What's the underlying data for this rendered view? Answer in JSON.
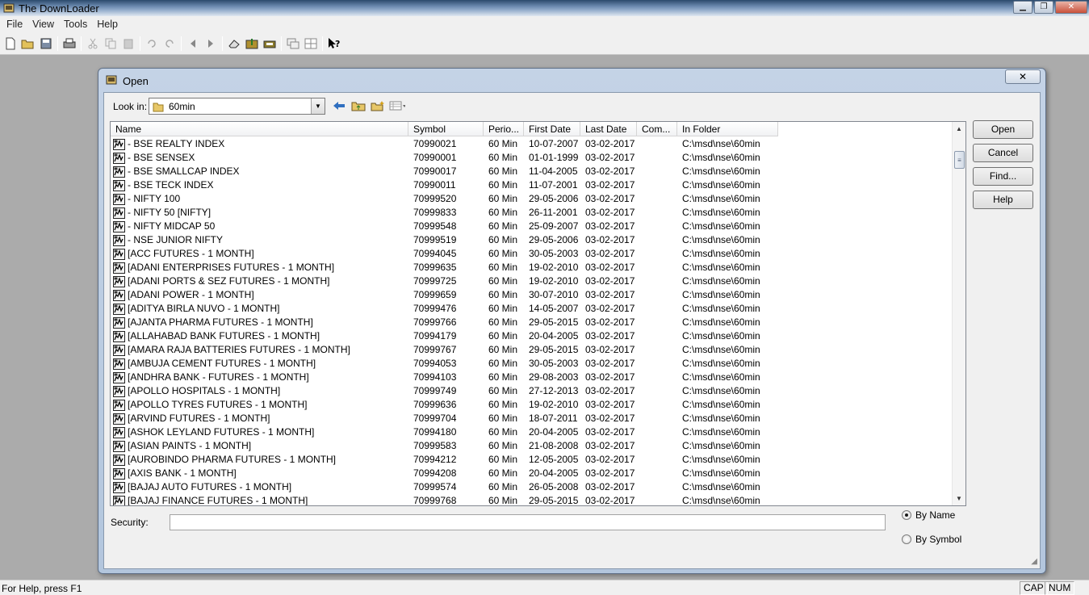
{
  "window": {
    "title": "The DownLoader"
  },
  "menubar": {
    "items": [
      "File",
      "View",
      "Tools",
      "Help"
    ]
  },
  "toolbar": {
    "icons": [
      "new-icon",
      "open-icon",
      "save-icon",
      "print-icon",
      "cut-icon",
      "copy-icon",
      "paste-icon",
      "undo-icon",
      "redo-icon",
      "back-icon",
      "forward-icon",
      "tool1-icon",
      "tool2-icon",
      "tool3-icon",
      "window-icon",
      "grid-icon",
      "help-pointer-icon"
    ]
  },
  "dialog": {
    "title": "Open",
    "close_label": "✕",
    "look_in_label": "Look in:",
    "look_in_value": "60min",
    "columns": [
      "Name",
      "Symbol",
      "Perio...",
      "First Date",
      "Last Date",
      "Com...",
      "In Folder"
    ],
    "rows": [
      {
        "name": "- BSE REALTY INDEX",
        "symbol": "70990021",
        "period": "60 Min",
        "first": "10-07-2007",
        "last": "03-02-2017",
        "com": "",
        "folder": "C:\\msd\\nse\\60min"
      },
      {
        "name": "- BSE SENSEX",
        "symbol": "70990001",
        "period": "60 Min",
        "first": "01-01-1999",
        "last": "03-02-2017",
        "com": "",
        "folder": "C:\\msd\\nse\\60min"
      },
      {
        "name": "- BSE SMALLCAP INDEX",
        "symbol": "70990017",
        "period": "60 Min",
        "first": "11-04-2005",
        "last": "03-02-2017",
        "com": "",
        "folder": "C:\\msd\\nse\\60min"
      },
      {
        "name": "- BSE TECK INDEX",
        "symbol": "70990011",
        "period": "60 Min",
        "first": "11-07-2001",
        "last": "03-02-2017",
        "com": "",
        "folder": "C:\\msd\\nse\\60min"
      },
      {
        "name": "- NIFTY 100",
        "symbol": "70999520",
        "period": "60 Min",
        "first": "29-05-2006",
        "last": "03-02-2017",
        "com": "",
        "folder": "C:\\msd\\nse\\60min"
      },
      {
        "name": "- NIFTY 50 [NIFTY]",
        "symbol": "70999833",
        "period": "60 Min",
        "first": "26-11-2001",
        "last": "03-02-2017",
        "com": "",
        "folder": "C:\\msd\\nse\\60min"
      },
      {
        "name": "- NIFTY MIDCAP 50",
        "symbol": "70999548",
        "period": "60 Min",
        "first": "25-09-2007",
        "last": "03-02-2017",
        "com": "",
        "folder": "C:\\msd\\nse\\60min"
      },
      {
        "name": "- NSE JUNIOR NIFTY",
        "symbol": "70999519",
        "period": "60 Min",
        "first": "29-05-2006",
        "last": "03-02-2017",
        "com": "",
        "folder": "C:\\msd\\nse\\60min"
      },
      {
        "name": "[ACC FUTURES - 1 MONTH]",
        "symbol": "70994045",
        "period": "60 Min",
        "first": "30-05-2003",
        "last": "03-02-2017",
        "com": "",
        "folder": "C:\\msd\\nse\\60min"
      },
      {
        "name": "[ADANI ENTERPRISES FUTURES - 1 MONTH]",
        "symbol": "70999635",
        "period": "60 Min",
        "first": "19-02-2010",
        "last": "03-02-2017",
        "com": "",
        "folder": "C:\\msd\\nse\\60min"
      },
      {
        "name": "[ADANI PORTS & SEZ FUTURES - 1 MONTH]",
        "symbol": "70999725",
        "period": "60 Min",
        "first": "19-02-2010",
        "last": "03-02-2017",
        "com": "",
        "folder": "C:\\msd\\nse\\60min"
      },
      {
        "name": "[ADANI POWER - 1 MONTH]",
        "symbol": "70999659",
        "period": "60 Min",
        "first": "30-07-2010",
        "last": "03-02-2017",
        "com": "",
        "folder": "C:\\msd\\nse\\60min"
      },
      {
        "name": "[ADITYA BIRLA NUVO - 1 MONTH]",
        "symbol": "70999476",
        "period": "60 Min",
        "first": "14-05-2007",
        "last": "03-02-2017",
        "com": "",
        "folder": "C:\\msd\\nse\\60min"
      },
      {
        "name": "[AJANTA PHARMA FUTURES - 1 MONTH]",
        "symbol": "70999766",
        "period": "60 Min",
        "first": "29-05-2015",
        "last": "03-02-2017",
        "com": "",
        "folder": "C:\\msd\\nse\\60min"
      },
      {
        "name": "[ALLAHABAD BANK FUTURES - 1 MONTH]",
        "symbol": "70994179",
        "period": "60 Min",
        "first": "20-04-2005",
        "last": "03-02-2017",
        "com": "",
        "folder": "C:\\msd\\nse\\60min"
      },
      {
        "name": "[AMARA RAJA BATTERIES FUTURES - 1 MONTH]",
        "symbol": "70999767",
        "period": "60 Min",
        "first": "29-05-2015",
        "last": "03-02-2017",
        "com": "",
        "folder": "C:\\msd\\nse\\60min"
      },
      {
        "name": "[AMBUJA CEMENT FUTURES - 1 MONTH]",
        "symbol": "70994053",
        "period": "60 Min",
        "first": "30-05-2003",
        "last": "03-02-2017",
        "com": "",
        "folder": "C:\\msd\\nse\\60min"
      },
      {
        "name": "[ANDHRA BANK - FUTURES - 1 MONTH]",
        "symbol": "70994103",
        "period": "60 Min",
        "first": "29-08-2003",
        "last": "03-02-2017",
        "com": "",
        "folder": "C:\\msd\\nse\\60min"
      },
      {
        "name": "[APOLLO HOSPITALS - 1 MONTH]",
        "symbol": "70999749",
        "period": "60 Min",
        "first": "27-12-2013",
        "last": "03-02-2017",
        "com": "",
        "folder": "C:\\msd\\nse\\60min"
      },
      {
        "name": "[APOLLO TYRES FUTURES - 1 MONTH]",
        "symbol": "70999636",
        "period": "60 Min",
        "first": "19-02-2010",
        "last": "03-02-2017",
        "com": "",
        "folder": "C:\\msd\\nse\\60min"
      },
      {
        "name": "[ARVIND  FUTURES - 1 MONTH]",
        "symbol": "70999704",
        "period": "60 Min",
        "first": "18-07-2011",
        "last": "03-02-2017",
        "com": "",
        "folder": "C:\\msd\\nse\\60min"
      },
      {
        "name": "[ASHOK LEYLAND FUTURES - 1 MONTH]",
        "symbol": "70994180",
        "period": "60 Min",
        "first": "20-04-2005",
        "last": "03-02-2017",
        "com": "",
        "folder": "C:\\msd\\nse\\60min"
      },
      {
        "name": "[ASIAN PAINTS - 1 MONTH]",
        "symbol": "70999583",
        "period": "60 Min",
        "first": "21-08-2008",
        "last": "03-02-2017",
        "com": "",
        "folder": "C:\\msd\\nse\\60min"
      },
      {
        "name": "[AUROBINDO PHARMA FUTURES - 1 MONTH]",
        "symbol": "70994212",
        "period": "60 Min",
        "first": "12-05-2005",
        "last": "03-02-2017",
        "com": "",
        "folder": "C:\\msd\\nse\\60min"
      },
      {
        "name": "[AXIS BANK - 1 MONTH]",
        "symbol": "70994208",
        "period": "60 Min",
        "first": "20-04-2005",
        "last": "03-02-2017",
        "com": "",
        "folder": "C:\\msd\\nse\\60min"
      },
      {
        "name": "[BAJAJ AUTO FUTURES - 1 MONTH]",
        "symbol": "70999574",
        "period": "60 Min",
        "first": "26-05-2008",
        "last": "03-02-2017",
        "com": "",
        "folder": "C:\\msd\\nse\\60min"
      },
      {
        "name": "[BAJAJ FINANCE FUTURES - 1 MONTH]",
        "symbol": "70999768",
        "period": "60 Min",
        "first": "29-05-2015",
        "last": "03-02-2017",
        "com": "",
        "folder": "C:\\msd\\nse\\60min"
      }
    ],
    "buttons": {
      "open": "Open",
      "cancel": "Cancel",
      "find": "Find...",
      "help": "Help"
    },
    "security_label": "Security:",
    "security_value": "",
    "radio": {
      "by_name": "By Name",
      "by_symbol": "By Symbol",
      "selected": "by_name"
    }
  },
  "statusbar": {
    "help_text": "For Help, press F1",
    "cap": "CAP",
    "num": "NUM"
  }
}
